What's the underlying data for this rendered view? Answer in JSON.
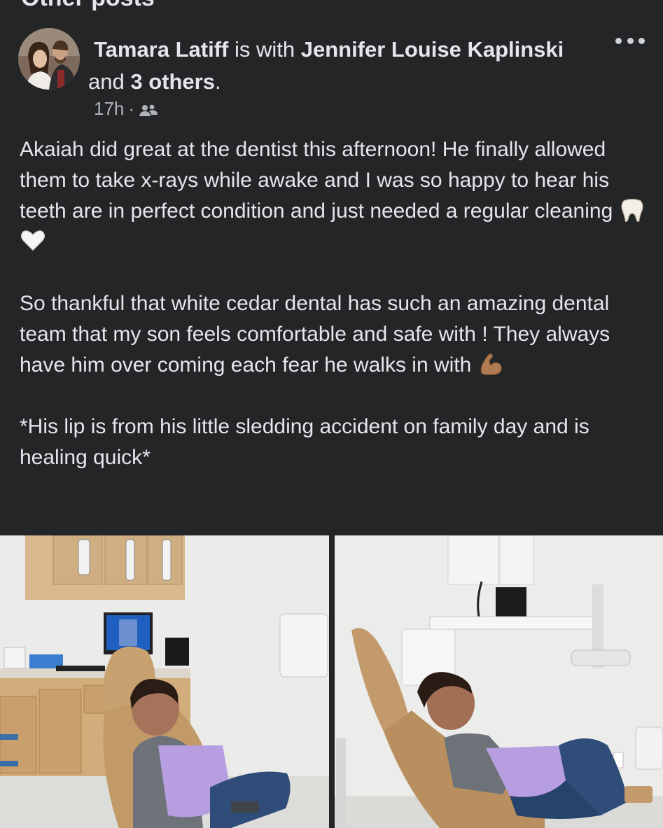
{
  "section": {
    "heading": "Other posts"
  },
  "post": {
    "author": "Tamara Latiff",
    "with_word": " is with ",
    "tagged": "Jennifer Louise Kaplinski",
    "and_word": " and ",
    "others": "3 others",
    "period": ".",
    "time": "17h",
    "separator": "·",
    "audience_icon": "friends-icon",
    "more_icon": "more-options-icon",
    "paragraphs": [
      "Akaiah did great at the dentist this afternoon! He finally allowed them to take x-rays while awake and I was so happy to hear his teeth are in perfect condition and just needed a regular cleaning",
      "So thankful that white cedar dental has such an amazing dental team that my son feels comfortable and safe with ! They always have him over coming each fear he walks in with",
      "*His lip is from his little sledding accident on family day and is healing quick*"
    ],
    "emojis": [
      "tooth-emoji",
      "white-heart-emoji",
      "flexed-biceps-emoji"
    ],
    "photos": [
      "dental-office-photo-1",
      "dental-office-photo-2"
    ]
  },
  "colors": {
    "background": "#242526",
    "text_primary": "#e4e6eb",
    "text_secondary": "#b0b3b8"
  }
}
